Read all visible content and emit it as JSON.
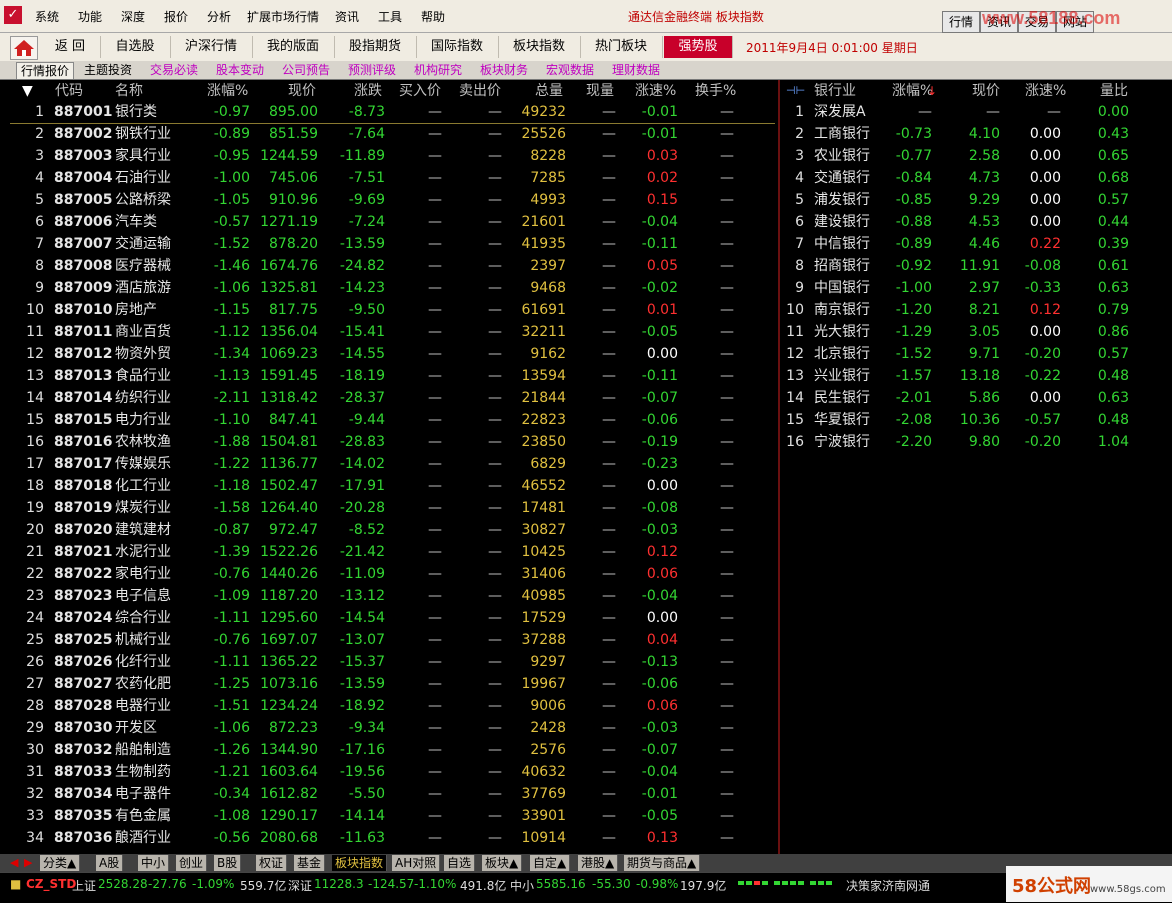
{
  "menu": [
    "系统",
    "功能",
    "深度",
    "报价",
    "分析",
    "扩展市场行情",
    "资讯",
    "工具",
    "帮助"
  ],
  "window_title": "通达信金融终端  板块指数",
  "top_buttons": [
    "行情",
    "资讯",
    "交易",
    "网站"
  ],
  "watermark": "www.58188.com",
  "toolbar": {
    "buttons": [
      "返 回",
      "自选股",
      "沪深行情",
      "我的版面",
      "股指期货",
      "国际指数",
      "板块指数",
      "热门板块",
      "强势股"
    ],
    "date": "2011年9月4日  0:01:00 星期日"
  },
  "subtabs": [
    "行情报价",
    "主题投资",
    "交易必读",
    "股本变动",
    "公司预告",
    "预测评级",
    "机构研究",
    "板块财务",
    "宏观数据",
    "理财数据"
  ],
  "main_table": {
    "headers": [
      "代码",
      "名称",
      "涨幅%",
      "现价",
      "涨跌",
      "买入价",
      "卖出价",
      "总量",
      "现量",
      "涨速%",
      "换手%"
    ],
    "rows": [
      [
        "1",
        "887001",
        "银行类",
        "-0.97",
        "895.00",
        "-8.73",
        "—",
        "—",
        "49232",
        "—",
        "-0.01",
        "—"
      ],
      [
        "2",
        "887002",
        "钢铁行业",
        "-0.89",
        "851.59",
        "-7.64",
        "—",
        "—",
        "25526",
        "—",
        "-0.01",
        "—"
      ],
      [
        "3",
        "887003",
        "家具行业",
        "-0.95",
        "1244.59",
        "-11.89",
        "—",
        "—",
        "8228",
        "—",
        "0.03",
        "—"
      ],
      [
        "4",
        "887004",
        "石油行业",
        "-1.00",
        "745.06",
        "-7.51",
        "—",
        "—",
        "7285",
        "—",
        "0.02",
        "—"
      ],
      [
        "5",
        "887005",
        "公路桥梁",
        "-1.05",
        "910.96",
        "-9.69",
        "—",
        "—",
        "4993",
        "—",
        "0.15",
        "—"
      ],
      [
        "6",
        "887006",
        "汽车类",
        "-0.57",
        "1271.19",
        "-7.24",
        "—",
        "—",
        "21601",
        "—",
        "-0.04",
        "—"
      ],
      [
        "7",
        "887007",
        "交通运输",
        "-1.52",
        "878.20",
        "-13.59",
        "—",
        "—",
        "41935",
        "—",
        "-0.11",
        "—"
      ],
      [
        "8",
        "887008",
        "医疗器械",
        "-1.46",
        "1674.76",
        "-24.82",
        "—",
        "—",
        "2397",
        "—",
        "0.05",
        "—"
      ],
      [
        "9",
        "887009",
        "酒店旅游",
        "-1.06",
        "1325.81",
        "-14.23",
        "—",
        "—",
        "9468",
        "—",
        "-0.02",
        "—"
      ],
      [
        "10",
        "887010",
        "房地产",
        "-1.15",
        "817.75",
        "-9.50",
        "—",
        "—",
        "61691",
        "—",
        "0.01",
        "—"
      ],
      [
        "11",
        "887011",
        "商业百货",
        "-1.12",
        "1356.04",
        "-15.41",
        "—",
        "—",
        "32211",
        "—",
        "-0.05",
        "—"
      ],
      [
        "12",
        "887012",
        "物资外贸",
        "-1.34",
        "1069.23",
        "-14.55",
        "—",
        "—",
        "9162",
        "—",
        "0.00",
        "—"
      ],
      [
        "13",
        "887013",
        "食品行业",
        "-1.13",
        "1591.45",
        "-18.19",
        "—",
        "—",
        "13594",
        "—",
        "-0.11",
        "—"
      ],
      [
        "14",
        "887014",
        "纺织行业",
        "-2.11",
        "1318.42",
        "-28.37",
        "—",
        "—",
        "21844",
        "—",
        "-0.07",
        "—"
      ],
      [
        "15",
        "887015",
        "电力行业",
        "-1.10",
        "847.41",
        "-9.44",
        "—",
        "—",
        "22823",
        "—",
        "-0.06",
        "—"
      ],
      [
        "16",
        "887016",
        "农林牧渔",
        "-1.88",
        "1504.81",
        "-28.83",
        "—",
        "—",
        "23850",
        "—",
        "-0.19",
        "—"
      ],
      [
        "17",
        "887017",
        "传媒娱乐",
        "-1.22",
        "1136.77",
        "-14.02",
        "—",
        "—",
        "6829",
        "—",
        "-0.23",
        "—"
      ],
      [
        "18",
        "887018",
        "化工行业",
        "-1.18",
        "1502.47",
        "-17.91",
        "—",
        "—",
        "46552",
        "—",
        "0.00",
        "—"
      ],
      [
        "19",
        "887019",
        "煤炭行业",
        "-1.58",
        "1264.40",
        "-20.28",
        "—",
        "—",
        "17481",
        "—",
        "-0.08",
        "—"
      ],
      [
        "20",
        "887020",
        "建筑建材",
        "-0.87",
        "972.47",
        "-8.52",
        "—",
        "—",
        "30827",
        "—",
        "-0.03",
        "—"
      ],
      [
        "21",
        "887021",
        "水泥行业",
        "-1.39",
        "1522.26",
        "-21.42",
        "—",
        "—",
        "10425",
        "—",
        "0.12",
        "—"
      ],
      [
        "22",
        "887022",
        "家电行业",
        "-0.76",
        "1440.26",
        "-11.09",
        "—",
        "—",
        "31406",
        "—",
        "0.06",
        "—"
      ],
      [
        "23",
        "887023",
        "电子信息",
        "-1.09",
        "1187.20",
        "-13.12",
        "—",
        "—",
        "40985",
        "—",
        "-0.04",
        "—"
      ],
      [
        "24",
        "887024",
        "综合行业",
        "-1.11",
        "1295.60",
        "-14.54",
        "—",
        "—",
        "17529",
        "—",
        "0.00",
        "—"
      ],
      [
        "25",
        "887025",
        "机械行业",
        "-0.76",
        "1697.07",
        "-13.07",
        "—",
        "—",
        "37288",
        "—",
        "0.04",
        "—"
      ],
      [
        "26",
        "887026",
        "化纤行业",
        "-1.11",
        "1365.22",
        "-15.37",
        "—",
        "—",
        "9297",
        "—",
        "-0.13",
        "—"
      ],
      [
        "27",
        "887027",
        "农药化肥",
        "-1.25",
        "1073.16",
        "-13.59",
        "—",
        "—",
        "19967",
        "—",
        "-0.06",
        "—"
      ],
      [
        "28",
        "887028",
        "电器行业",
        "-1.51",
        "1234.24",
        "-18.92",
        "—",
        "—",
        "9006",
        "—",
        "0.06",
        "—"
      ],
      [
        "29",
        "887030",
        "开发区",
        "-1.06",
        "872.23",
        "-9.34",
        "—",
        "—",
        "2428",
        "—",
        "-0.03",
        "—"
      ],
      [
        "30",
        "887032",
        "船舶制造",
        "-1.26",
        "1344.90",
        "-17.16",
        "—",
        "—",
        "2576",
        "—",
        "-0.07",
        "—"
      ],
      [
        "31",
        "887033",
        "生物制药",
        "-1.21",
        "1603.64",
        "-19.56",
        "—",
        "—",
        "40632",
        "—",
        "-0.04",
        "—"
      ],
      [
        "32",
        "887034",
        "电子器件",
        "-0.34",
        "1612.82",
        "-5.50",
        "—",
        "—",
        "37769",
        "—",
        "-0.01",
        "—"
      ],
      [
        "33",
        "887035",
        "有色金属",
        "-1.08",
        "1290.17",
        "-14.14",
        "—",
        "—",
        "33901",
        "—",
        "-0.05",
        "—"
      ],
      [
        "34",
        "887036",
        "酿酒行业",
        "-0.56",
        "2080.68",
        "-11.63",
        "—",
        "—",
        "10914",
        "—",
        "0.13",
        "—"
      ]
    ]
  },
  "side_table": {
    "headers": [
      "银行业",
      "涨幅%",
      "现价",
      "涨速%",
      "量比"
    ],
    "rows": [
      [
        "1",
        "深发展A",
        "—",
        "—",
        "—",
        "0.00"
      ],
      [
        "2",
        "工商银行",
        "-0.73",
        "4.10",
        "0.00",
        "0.43"
      ],
      [
        "3",
        "农业银行",
        "-0.77",
        "2.58",
        "0.00",
        "0.65"
      ],
      [
        "4",
        "交通银行",
        "-0.84",
        "4.73",
        "0.00",
        "0.68"
      ],
      [
        "5",
        "浦发银行",
        "-0.85",
        "9.29",
        "0.00",
        "0.57"
      ],
      [
        "6",
        "建设银行",
        "-0.88",
        "4.53",
        "0.00",
        "0.44"
      ],
      [
        "7",
        "中信银行",
        "-0.89",
        "4.46",
        "0.22",
        "0.39"
      ],
      [
        "8",
        "招商银行",
        "-0.92",
        "11.91",
        "-0.08",
        "0.61"
      ],
      [
        "9",
        "中国银行",
        "-1.00",
        "2.97",
        "-0.33",
        "0.63"
      ],
      [
        "10",
        "南京银行",
        "-1.20",
        "8.21",
        "0.12",
        "0.79"
      ],
      [
        "11",
        "光大银行",
        "-1.29",
        "3.05",
        "0.00",
        "0.86"
      ],
      [
        "12",
        "北京银行",
        "-1.52",
        "9.71",
        "-0.20",
        "0.57"
      ],
      [
        "13",
        "兴业银行",
        "-1.57",
        "13.18",
        "-0.22",
        "0.48"
      ],
      [
        "14",
        "民生银行",
        "-2.01",
        "5.86",
        "0.00",
        "0.63"
      ],
      [
        "15",
        "华夏银行",
        "-2.08",
        "10.36",
        "-0.57",
        "0.48"
      ],
      [
        "16",
        "宁波银行",
        "-2.20",
        "9.80",
        "-0.20",
        "1.04"
      ]
    ]
  },
  "bottom_tabs": [
    "分类▲",
    "A股",
    "中小",
    "创业",
    "B股",
    "权证",
    "基金",
    "板块指数",
    "AH对照",
    "自选",
    "板块▲",
    "自定▲",
    "港股▲",
    "期货与商品▲"
  ],
  "status": {
    "account": "CZ_STD",
    "sh_label": "上证",
    "sh_price": "2528.28",
    "sh_chg": "-27.76",
    "sh_pct": "-1.09%",
    "sh_vol": "559.7亿",
    "sz_label": "深证",
    "sz_price": "11228.3",
    "sz_chg": "-124.57",
    "sz_pct": "-1.10%",
    "sz_vol": "491.8亿",
    "zx_label": "中小",
    "zx_price": "5585.16",
    "zx_chg": "-55.30",
    "zx_pct": "-0.98%",
    "zx_vol": "197.9亿",
    "server": "决策家济南网通",
    "brand_logo": "58公式网",
    "brand_url": "www.58gs.com"
  },
  "colors": {
    "up": "#ff3030",
    "down": "#33d633",
    "flat": "#ffffff",
    "volume": "#e0c040",
    "accent": "#c8002a"
  }
}
